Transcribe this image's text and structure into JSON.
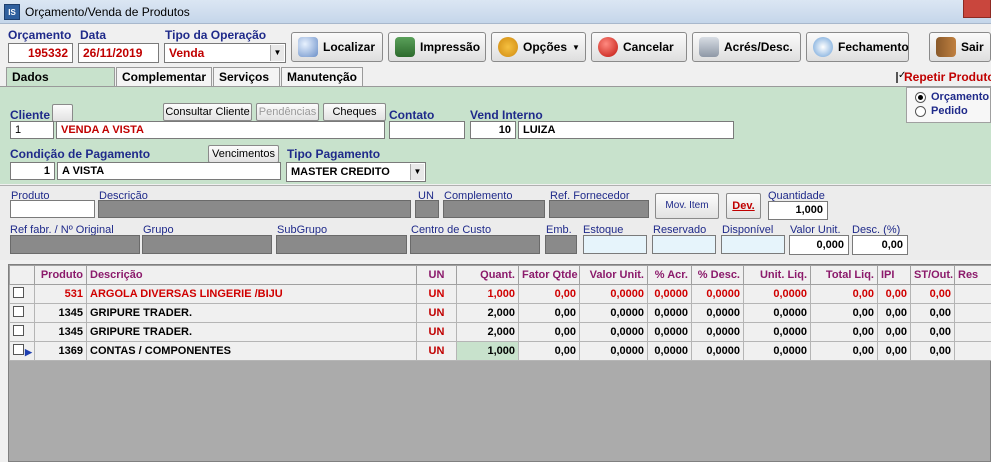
{
  "window": {
    "app_icon": "IS",
    "title": "Orçamento/Venda de Produtos"
  },
  "header": {
    "orcamento_label": "Orçamento",
    "orcamento_value": "195332",
    "data_label": "Data",
    "data_value": "26/11/2019",
    "tipo_label": "Tipo da Operação",
    "tipo_value": "Venda"
  },
  "toolbar": {
    "localizar": "Localizar",
    "impressao": "Impressão",
    "opcoes": "Opções",
    "cancelar": "Cancelar",
    "acres": "Acrés/Desc.",
    "fechamento": "Fechamento",
    "sair": "Sair"
  },
  "tabs": [
    "Dados Principais",
    "Complementar",
    "Serviços",
    "Manutenção"
  ],
  "repetir": "Repetir Produto",
  "radio": {
    "orcamento": "Orçamento",
    "pedido": "Pedido"
  },
  "cliente": {
    "label": "Cliente",
    "code": "1",
    "name": "VENDA A VISTA",
    "consultar": "Consultar Cliente",
    "pendencias": "Pendências",
    "cheques": "Cheques"
  },
  "contato": {
    "label": "Contato",
    "value": ""
  },
  "vend": {
    "label": "Vend Interno",
    "code": "10",
    "name": "LUIZA"
  },
  "cond": {
    "label": "Condição de Pagamento",
    "code": "1",
    "name": "A VISTA",
    "vencimentos": "Vencimentos"
  },
  "tipo_pag": {
    "label": "Tipo Pagamento",
    "value": "MASTER CREDITO"
  },
  "item": {
    "produto": "Produto",
    "descricao": "Descrição",
    "un": "UN",
    "complemento": "Complemento",
    "ref_forn": "Ref. Fornecedor",
    "mov_item": "Mov. Item",
    "dev": "Dev.",
    "quantidade": "Quantidade",
    "quantidade_value": "1,000",
    "ref_fabr": "Ref fabr. / Nº Original",
    "grupo": "Grupo",
    "subgrupo": "SubGrupo",
    "centro": "Centro de Custo",
    "emb": "Emb.",
    "estoque": "Estoque",
    "reservado": "Reservado",
    "disponivel": "Disponível",
    "valor_unit": "Valor Unit.",
    "valor_unit_value": "0,000",
    "desc_pct": "Desc. (%)",
    "desc_pct_value": "0,00"
  },
  "grid": {
    "columns": [
      "Produto",
      "Descrição",
      "UN",
      "Quant.",
      "Fator Qtde",
      "Valor Unit.",
      "% Acr.",
      "% Desc.",
      "Unit. Liq.",
      "Total Liq.",
      "IPI",
      "ST/Out.",
      "Res"
    ],
    "rows": [
      {
        "produto": "531",
        "descricao": "ARGOLA DIVERSAS LINGERIE /BIJU",
        "un": "UN",
        "quant": "1,000",
        "fator": "0,00",
        "valor": "0,0000",
        "acr": "0,0000",
        "desc": "0,0000",
        "unit": "0,0000",
        "total": "0,00",
        "ipi": "0,00",
        "st": "0,00"
      },
      {
        "produto": "1345",
        "descricao": "GRIPURE TRADER.",
        "un": "UN",
        "quant": "2,000",
        "fator": "0,00",
        "valor": "0,0000",
        "acr": "0,0000",
        "desc": "0,0000",
        "unit": "0,0000",
        "total": "0,00",
        "ipi": "0,00",
        "st": "0,00"
      },
      {
        "produto": "1345",
        "descricao": "GRIPURE TRADER.",
        "un": "UN",
        "quant": "2,000",
        "fator": "0,00",
        "valor": "0,0000",
        "acr": "0,0000",
        "desc": "0,0000",
        "unit": "0,0000",
        "total": "0,00",
        "ipi": "0,00",
        "st": "0,00"
      },
      {
        "produto": "1369",
        "descricao": "CONTAS / COMPONENTES",
        "un": "UN",
        "quant": "1,000",
        "fator": "0,00",
        "valor": "0,0000",
        "acr": "0,0000",
        "desc": "0,0000",
        "unit": "0,0000",
        "total": "0,00",
        "ipi": "0,00",
        "st": "0,00"
      }
    ]
  }
}
